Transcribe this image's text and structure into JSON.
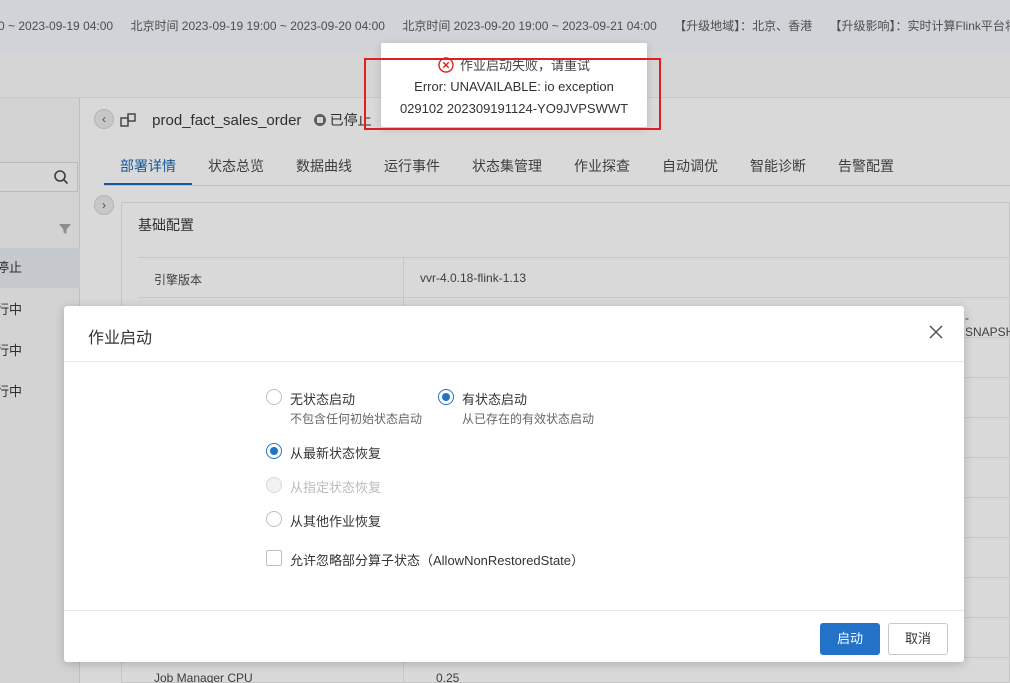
{
  "notice": {
    "items": [
      "0 ~ 2023-09-19 04:00",
      "北京时间 2023-09-19 19:00 ~ 2023-09-20 04:00",
      "北京时间 2023-09-20 19:00 ~ 2023-09-21 04:00",
      "【升级地域】：北京、香港",
      "【升级影响】：实时计算Flink平台将"
    ]
  },
  "left_panel": {
    "items": [
      "停止",
      "行中",
      "行中",
      "行中"
    ]
  },
  "job": {
    "name": "prod_fact_sales_order",
    "status": "已停止"
  },
  "tabs": [
    "部署详情",
    "状态总览",
    "数据曲线",
    "运行事件",
    "状态集管理",
    "作业探查",
    "自动调优",
    "智能诊断",
    "告警配置"
  ],
  "config": {
    "section_title": "基础配置",
    "rows": [
      {
        "key": "引擎版本",
        "value": "vvr-4.0.18-flink-1.13"
      },
      {
        "key": "",
        "value": "-SNAPSH"
      },
      {
        "key": "Job Manager CPU",
        "value": "0.25"
      }
    ]
  },
  "toast": {
    "title": "作业启动失败，请重试",
    "line1": "Error: UNAVAILABLE: io exception",
    "line2": "029102 202309191124-YO9JVPSWWT"
  },
  "modal": {
    "title": "作业启动",
    "stateless_label": "无状态启动",
    "stateless_desc": "不包含任何初始状态启动",
    "stateful_label": "有状态启动",
    "stateful_desc": "从已存在的有效状态启动",
    "restore_latest": "从最新状态恢复",
    "restore_specified": "从指定状态恢复",
    "restore_other": "从其他作业恢复",
    "allow_non_restored": "允许忽略部分算子状态（AllowNonRestoredState）",
    "start_button": "启动",
    "cancel_button": "取消"
  },
  "colors": {
    "primary": "#2273c8",
    "highlight": "#e02020",
    "error_icon": "#e02020"
  }
}
